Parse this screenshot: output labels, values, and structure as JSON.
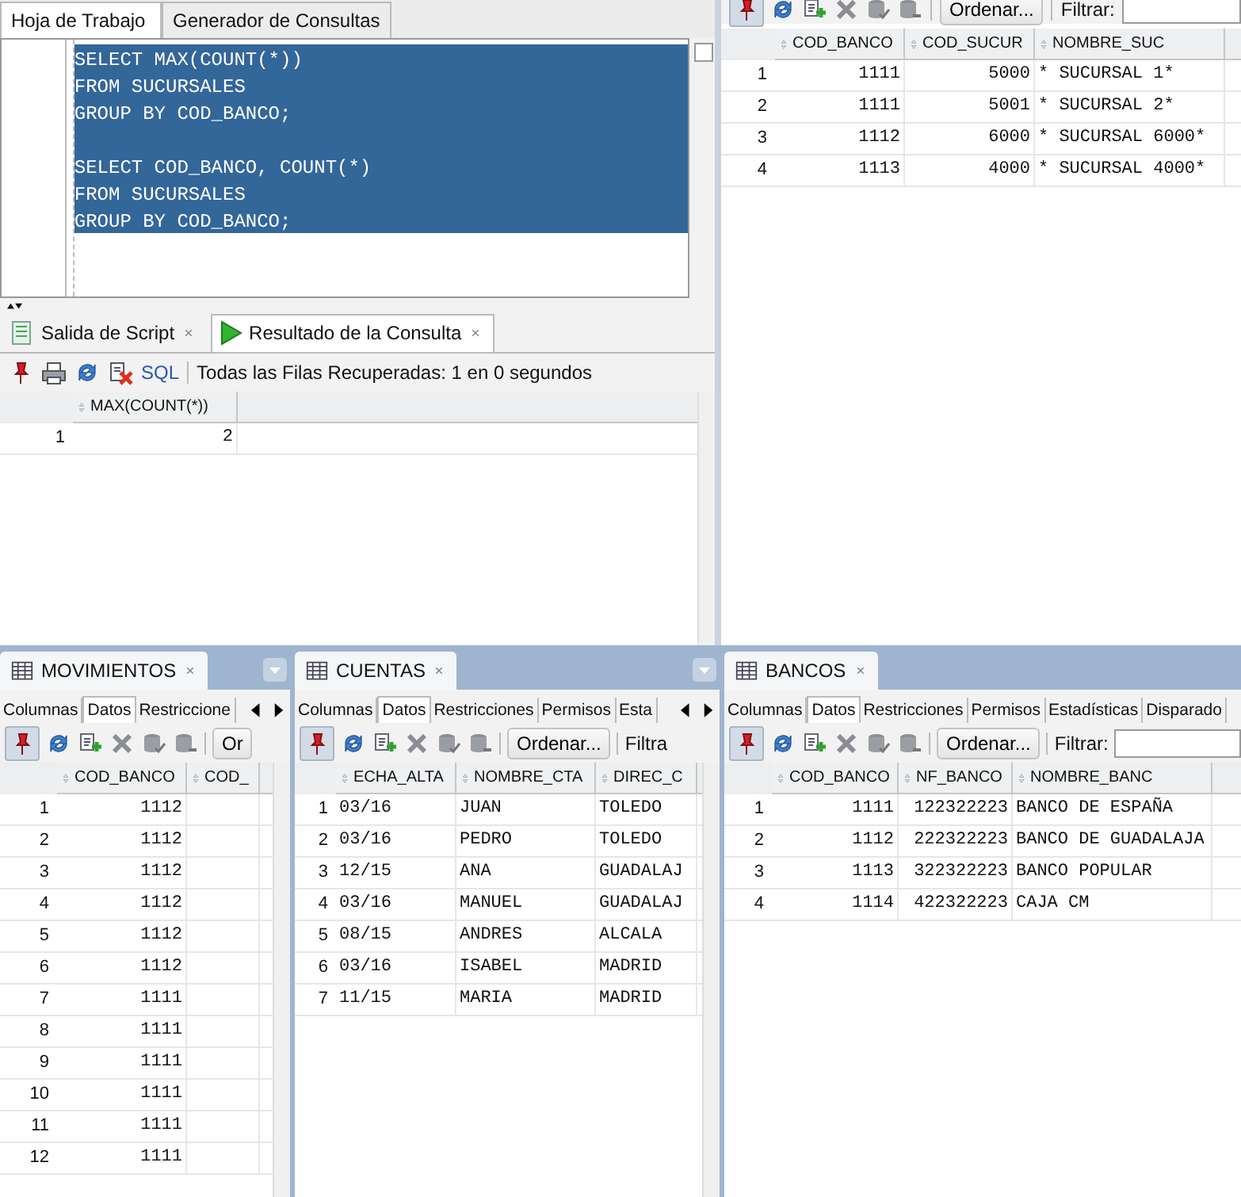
{
  "worksheet": {
    "tabs": [
      {
        "label": "Hoja de Trabajo",
        "selected": true
      },
      {
        "label": "Generador de Consultas",
        "selected": false
      }
    ],
    "editor": {
      "selected": true,
      "statements": [
        [
          "SELECT MAX(COUNT(*))",
          "FROM SUCURSALES",
          "GROUP BY COD_BANCO;"
        ],
        [
          "SELECT COD_BANCO, COUNT(*)",
          "FROM SUCURSALES",
          "GROUP BY COD_BANCO;"
        ]
      ]
    }
  },
  "result_panel": {
    "tabs": [
      {
        "label": "Salida de Script",
        "selected": false
      },
      {
        "label": "Resultado de la Consulta",
        "selected": true
      }
    ],
    "sql_link": "SQL",
    "status": "Todas las Filas Recuperadas: 1 en 0 segundos",
    "grid": {
      "columns": [
        {
          "label": "MAX(COUNT(*))",
          "kind": "number"
        }
      ],
      "rows": [
        {
          "num": "1",
          "cells": [
            "2"
          ]
        }
      ]
    }
  },
  "sucursales": {
    "toolbar": {
      "sort_button": "Ordenar...",
      "filter_label": "Filtrar:",
      "filter_field": true
    },
    "grid": {
      "columns": [
        {
          "label": "COD_BANCO",
          "kind": "number"
        },
        {
          "label": "COD_SUCUR",
          "kind": "number"
        },
        {
          "label": "NOMBRE_SUC",
          "kind": "text"
        }
      ],
      "rows": [
        {
          "num": "1",
          "cells": [
            "1111",
            "5000",
            "* SUCURSAL 1*"
          ]
        },
        {
          "num": "2",
          "cells": [
            "1111",
            "5001",
            "* SUCURSAL 2*"
          ]
        },
        {
          "num": "3",
          "cells": [
            "1112",
            "6000",
            "* SUCURSAL 6000*"
          ]
        },
        {
          "num": "4",
          "cells": [
            "1113",
            "4000",
            "* SUCURSAL 4000*"
          ]
        }
      ]
    }
  },
  "tables": [
    {
      "title": "MOVIMIENTOS",
      "menu": true,
      "subtabs": [
        {
          "label": "Columnas",
          "selected": false
        },
        {
          "label": "Datos",
          "selected": true
        },
        {
          "label": "Restriccione",
          "selected": false
        }
      ],
      "toolbar": {
        "sort_button": "Or",
        "filter_field": false
      },
      "grid": {
        "columns": [
          {
            "label": "COD_BANCO",
            "kind": "number"
          },
          {
            "label": "COD_",
            "kind": "number"
          }
        ],
        "rows": [
          {
            "num": "1",
            "cells": [
              "1112",
              ""
            ]
          },
          {
            "num": "2",
            "cells": [
              "1112",
              ""
            ]
          },
          {
            "num": "3",
            "cells": [
              "1112",
              ""
            ]
          },
          {
            "num": "4",
            "cells": [
              "1112",
              ""
            ]
          },
          {
            "num": "5",
            "cells": [
              "1112",
              ""
            ]
          },
          {
            "num": "6",
            "cells": [
              "1112",
              ""
            ]
          },
          {
            "num": "7",
            "cells": [
              "1111",
              ""
            ]
          },
          {
            "num": "8",
            "cells": [
              "1111",
              ""
            ]
          },
          {
            "num": "9",
            "cells": [
              "1111",
              ""
            ]
          },
          {
            "num": "10",
            "cells": [
              "1111",
              ""
            ]
          },
          {
            "num": "11",
            "cells": [
              "1111",
              ""
            ]
          },
          {
            "num": "12",
            "cells": [
              "1111",
              ""
            ]
          }
        ]
      }
    },
    {
      "title": "CUENTAS",
      "menu": true,
      "subtabs": [
        {
          "label": "Columnas",
          "selected": false
        },
        {
          "label": "Datos",
          "selected": true
        },
        {
          "label": "Restricciones",
          "selected": false
        },
        {
          "label": "Permisos",
          "selected": false
        },
        {
          "label": "Esta",
          "selected": false
        }
      ],
      "toolbar": {
        "sort_button": "Ordenar...",
        "filter_label": "Filtra",
        "filter_field": false
      },
      "grid": {
        "columns": [
          {
            "label": "ECHA_ALTA",
            "kind": "text"
          },
          {
            "label": "NOMBRE_CTA",
            "kind": "text"
          },
          {
            "label": "DIREC_C",
            "kind": "text"
          }
        ],
        "rows": [
          {
            "num": "1",
            "cells": [
              "03/16",
              "JUAN",
              "TOLEDO"
            ]
          },
          {
            "num": "2",
            "cells": [
              "03/16",
              "PEDRO",
              "TOLEDO"
            ]
          },
          {
            "num": "3",
            "cells": [
              "12/15",
              "ANA",
              "GUADALAJ"
            ]
          },
          {
            "num": "4",
            "cells": [
              "03/16",
              "MANUEL",
              "GUADALAJ"
            ]
          },
          {
            "num": "5",
            "cells": [
              "08/15",
              "ANDRES",
              "ALCALA"
            ]
          },
          {
            "num": "6",
            "cells": [
              "03/16",
              "ISABEL",
              "MADRID"
            ]
          },
          {
            "num": "7",
            "cells": [
              "11/15",
              "MARIA",
              "MADRID"
            ]
          }
        ]
      }
    },
    {
      "title": "BANCOS",
      "menu": false,
      "subtabs": [
        {
          "label": "Columnas",
          "selected": false
        },
        {
          "label": "Datos",
          "selected": true
        },
        {
          "label": "Restricciones",
          "selected": false
        },
        {
          "label": "Permisos",
          "selected": false
        },
        {
          "label": "Estadísticas",
          "selected": false
        },
        {
          "label": "Disparado",
          "selected": false
        }
      ],
      "toolbar": {
        "sort_button": "Ordenar...",
        "filter_label": "Filtrar:",
        "filter_field": true
      },
      "grid": {
        "columns": [
          {
            "label": "COD_BANCO",
            "kind": "number"
          },
          {
            "label": "NF_BANCO",
            "kind": "number"
          },
          {
            "label": "NOMBRE_BANC",
            "kind": "text"
          }
        ],
        "rows": [
          {
            "num": "1",
            "cells": [
              "1111",
              "122322223",
              "BANCO DE ESPAÑA"
            ]
          },
          {
            "num": "2",
            "cells": [
              "1112",
              "222322223",
              "BANCO DE GUADALAJA"
            ]
          },
          {
            "num": "3",
            "cells": [
              "1113",
              "322322223",
              "BANCO POPULAR"
            ]
          },
          {
            "num": "4",
            "cells": [
              "1114",
              "422322223",
              "CAJA CM"
            ]
          }
        ]
      }
    }
  ]
}
